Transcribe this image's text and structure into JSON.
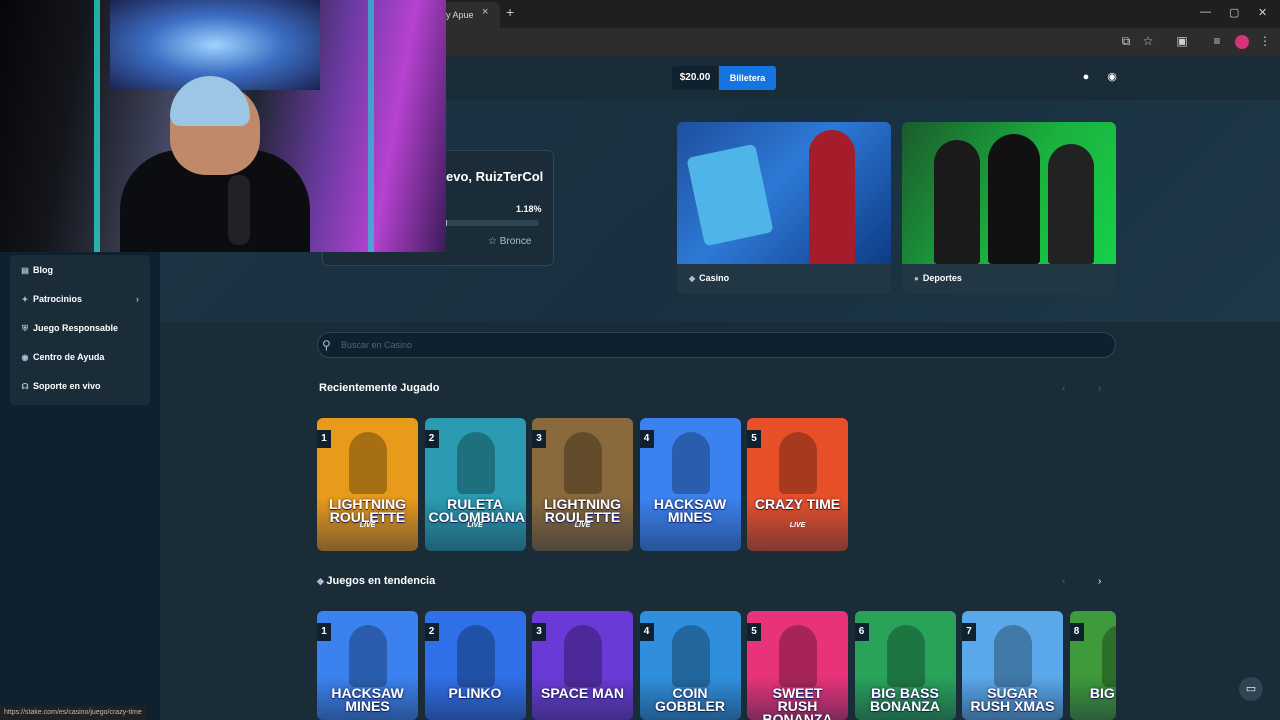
{
  "browser": {
    "tab_title": "y Apue",
    "tab_close": "×",
    "new_tab": "+",
    "window_buttons": [
      "—",
      "▢",
      "✕"
    ]
  },
  "header": {
    "balance": "$20.00",
    "wallet_button": "Billetera"
  },
  "welcome": {
    "greeting": "evo, RuizTerCol",
    "progress_pct": "1.18%",
    "progress_fraction": 0.0118,
    "rank": "Bronce"
  },
  "promos": [
    {
      "label": "Casino",
      "icon": "chip-icon"
    },
    {
      "label": "Deportes",
      "icon": "ball-icon"
    }
  ],
  "sidebar": {
    "items": [
      {
        "label": "Blog",
        "icon": "blog-icon"
      },
      {
        "label": "Patrocinios",
        "icon": "sponsor-icon",
        "has_chevron": true
      },
      {
        "label": "Juego Responsable",
        "icon": "shield-icon"
      },
      {
        "label": "Centro de Ayuda",
        "icon": "help-icon"
      },
      {
        "label": "Soporte en vivo",
        "icon": "headset-icon"
      }
    ]
  },
  "search": {
    "placeholder": "Buscar en Casino",
    "value": ""
  },
  "recent": {
    "title": "Recientemente Jugado",
    "games": [
      {
        "rank": "1",
        "name": "LIGHTNING ROULETTE",
        "sub": "LIVE",
        "color": "#e89a1b"
      },
      {
        "rank": "2",
        "name": "RULETA COLOMBIANA",
        "sub": "LIVE",
        "color": "#2a9bb0"
      },
      {
        "rank": "3",
        "name": "LIGHTNING ROULETTE",
        "sub": "LIVE",
        "color": "#8a6a3c"
      },
      {
        "rank": "4",
        "name": "HACKSAW MINES",
        "sub": "",
        "color": "#3b82f0"
      },
      {
        "rank": "5",
        "name": "CRAZY TIME",
        "sub": "LIVE",
        "color": "#e8502a"
      }
    ]
  },
  "trending": {
    "title": "Juegos en tendencia",
    "games": [
      {
        "rank": "1",
        "name": "HACKSAW MINES",
        "color": "#3b82f0"
      },
      {
        "rank": "2",
        "name": "PLINKO",
        "color": "#2f6fe8"
      },
      {
        "rank": "3",
        "name": "SPACE MAN",
        "color": "#6a3ad6"
      },
      {
        "rank": "4",
        "name": "COIN GOBBLER",
        "color": "#2f8fdc"
      },
      {
        "rank": "5",
        "name": "SWEET RUSH BONANZA",
        "color": "#e8337a"
      },
      {
        "rank": "6",
        "name": "BIG BASS BONANZA",
        "color": "#29a35a"
      },
      {
        "rank": "7",
        "name": "SUGAR RUSH XMAS",
        "color": "#5aa8ea"
      },
      {
        "rank": "8",
        "name": "BIG AMA",
        "color": "#3e9a3a"
      }
    ]
  },
  "status_url": "https://stake.com/es/casino/juego/crazy-time",
  "colors": {
    "background": "#1a2c38",
    "sidebar": "#0f212e",
    "accent": "#1475e1",
    "muted_text": "#b1bad3"
  }
}
